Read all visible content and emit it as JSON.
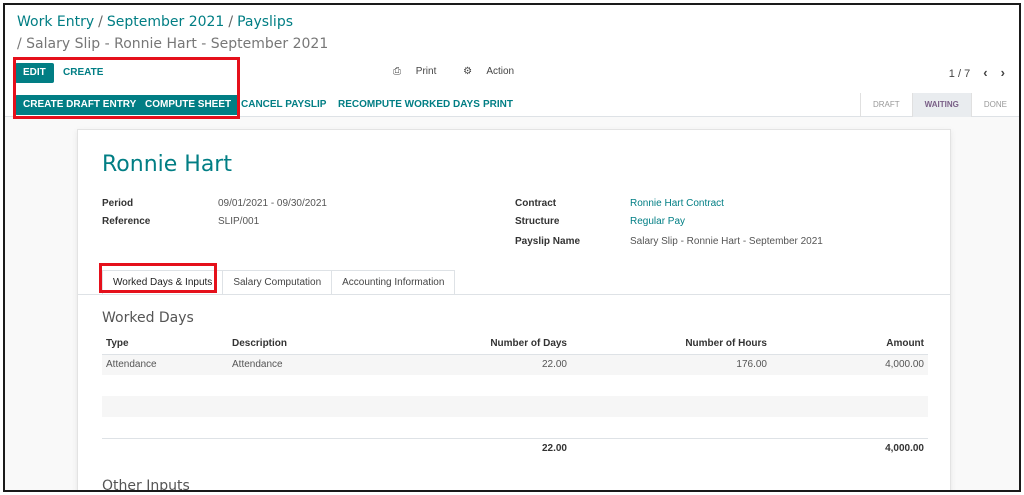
{
  "breadcrumb": {
    "items": [
      "Work Entry",
      "September 2021",
      "Payslips"
    ],
    "current": "/ Salary Slip - Ronnie Hart - September 2021"
  },
  "toolbar": {
    "edit_label": "EDIT",
    "create_label": "CREATE",
    "print_label": "Print",
    "action_label": "Action",
    "pager": "1 / 7"
  },
  "actions": {
    "create_draft_entry": "CREATE DRAFT ENTRY",
    "compute_sheet": "COMPUTE SHEET",
    "cancel_payslip": "CANCEL PAYSLIP",
    "recompute_worked_days": "RECOMPUTE WORKED DAYS",
    "print": "PRINT"
  },
  "status": {
    "stages": [
      "DRAFT",
      "WAITING",
      "DONE"
    ],
    "active": "WAITING"
  },
  "form": {
    "employee": "Ronnie Hart",
    "period_label": "Period",
    "period_value": "09/01/2021 - 09/30/2021",
    "reference_label": "Reference",
    "reference_value": "SLIP/001",
    "contract_label": "Contract",
    "contract_value": "Ronnie Hart Contract",
    "structure_label": "Structure",
    "structure_value": "Regular Pay",
    "payslip_name_label": "Payslip Name",
    "payslip_name_value": "Salary Slip - Ronnie Hart - September 2021"
  },
  "tabs": [
    "Worked Days & Inputs",
    "Salary Computation",
    "Accounting Information"
  ],
  "worked_days": {
    "title": "Worked Days",
    "columns": [
      "Type",
      "Description",
      "Number of Days",
      "Number of Hours",
      "Amount"
    ],
    "rows": [
      {
        "type": "Attendance",
        "description": "Attendance",
        "days": "22.00",
        "hours": "176.00",
        "amount": "4,000.00"
      }
    ],
    "total_days": "22.00",
    "total_amount": "4,000.00"
  },
  "other_inputs": {
    "title": "Other Inputs"
  },
  "colors": {
    "accent": "#017e84",
    "highlight": "#e5101b",
    "stage_active": "#7a5f87"
  }
}
